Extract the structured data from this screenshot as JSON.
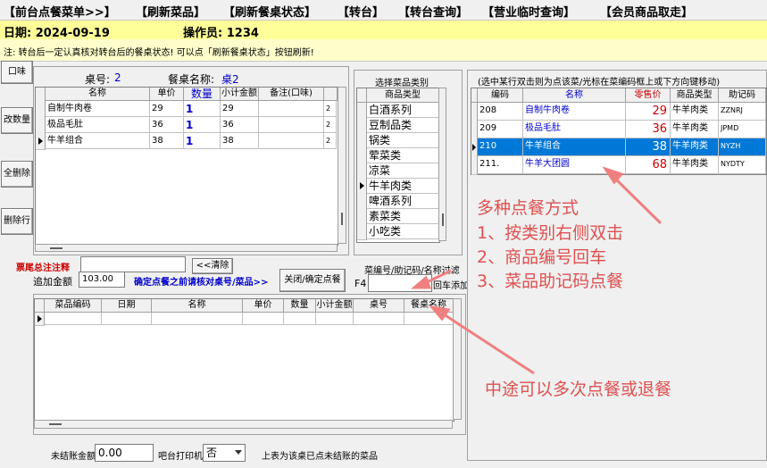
{
  "menu": [
    "【前台点餐菜单>>】",
    "【刷新菜品】",
    "【刷新餐桌状态】",
    "【转台】",
    "【转台查询】",
    "【营业临时查询】",
    "【会员商品取走】"
  ],
  "info": {
    "date_label": "日期: 2024-09-19",
    "operator_label": "操作员: 1234"
  },
  "note": "注: 转台后一定认真核对转台后的餐桌状态! 可以点「刷新餐桌状态」按钮刷新!",
  "side_buttons": [
    "口味",
    "改数量",
    "全删除",
    "删除行"
  ],
  "table": {
    "no_label": "桌号:",
    "no_value": "2",
    "name_label": "餐桌名称:",
    "name_value": "桌2"
  },
  "order_grid": {
    "headers": [
      "名称",
      "单价",
      "数量",
      "小计金额",
      "备注(口味)"
    ],
    "rows": [
      {
        "name": "自制牛肉卷",
        "price": "29",
        "qty": "1",
        "subtotal": "29",
        "note": "",
        "extra": "2"
      },
      {
        "name": "极品毛肚",
        "price": "36",
        "qty": "1",
        "subtotal": "36",
        "note": "",
        "extra": "2"
      },
      {
        "name": "牛羊组合",
        "price": "38",
        "qty": "1",
        "subtotal": "38",
        "note": "",
        "extra": "2"
      }
    ]
  },
  "category": {
    "title": "选择菜品类别",
    "header": "商品类型",
    "items": [
      "白酒系列",
      "豆制品类",
      "锅类",
      "荤菜类",
      "凉菜",
      "牛羊肉类",
      "啤酒系列",
      "素菜类",
      "小吃类"
    ]
  },
  "product_grid": {
    "caption": "(选中某行双击则为点该菜/光标在菜编码框上或下方向键移动)",
    "headers": [
      "编码",
      "名称",
      "零售价",
      "商品类型",
      "助记码"
    ],
    "rows": [
      {
        "code": "208",
        "name": "自制牛肉卷",
        "price": "29",
        "type": "牛羊肉类",
        "mnemonic": "ZZNRJ"
      },
      {
        "code": "209",
        "name": "极品毛肚",
        "price": "36",
        "type": "牛羊肉类",
        "mnemonic": "JPMD"
      },
      {
        "code": "210",
        "name": "牛羊组合",
        "price": "38",
        "type": "牛羊肉类",
        "mnemonic": "NYZH"
      },
      {
        "code": "211.",
        "name": "牛羊大团圆",
        "price": "68",
        "type": "牛羊肉类",
        "mnemonic": "NYDTY"
      }
    ]
  },
  "footer_note": {
    "label": "票尾总注注释",
    "value": "",
    "clear_button": "<<清除"
  },
  "add_amount": {
    "label": "追加金额",
    "value": "103.00"
  },
  "confirm_tip": "确定点餐之前请核对桌号/菜品>>",
  "close_confirm_button": "关闭/确定点餐",
  "filter": {
    "label": "菜编号/助记码/名称过滤",
    "f4": "F4",
    "value": "",
    "enter_label": "回车添加"
  },
  "history_grid": {
    "headers": [
      "菜品编码",
      "日期",
      "名称",
      "单价",
      "数量",
      "小计金额",
      "桌号",
      "餐桌名称"
    ]
  },
  "bottom": {
    "unpaid_label": "未结账金额",
    "unpaid_value": "0.00",
    "printer_label": "吧台打印机",
    "printer_value": "否",
    "printer_note": "上表为该桌已点未结账的菜品"
  },
  "annotations": {
    "line0": "多种点餐方式",
    "line1": "1、按类别右侧双击",
    "line2": "2、商品编号回车",
    "line3": "3、菜品助记码点餐",
    "line4": "中途可以多次点餐或退餐"
  },
  "colors": {
    "highlight": "#0078d7",
    "annotation": "#e05050",
    "blue_text": "#0000cc",
    "price_red": "#cc0000"
  }
}
